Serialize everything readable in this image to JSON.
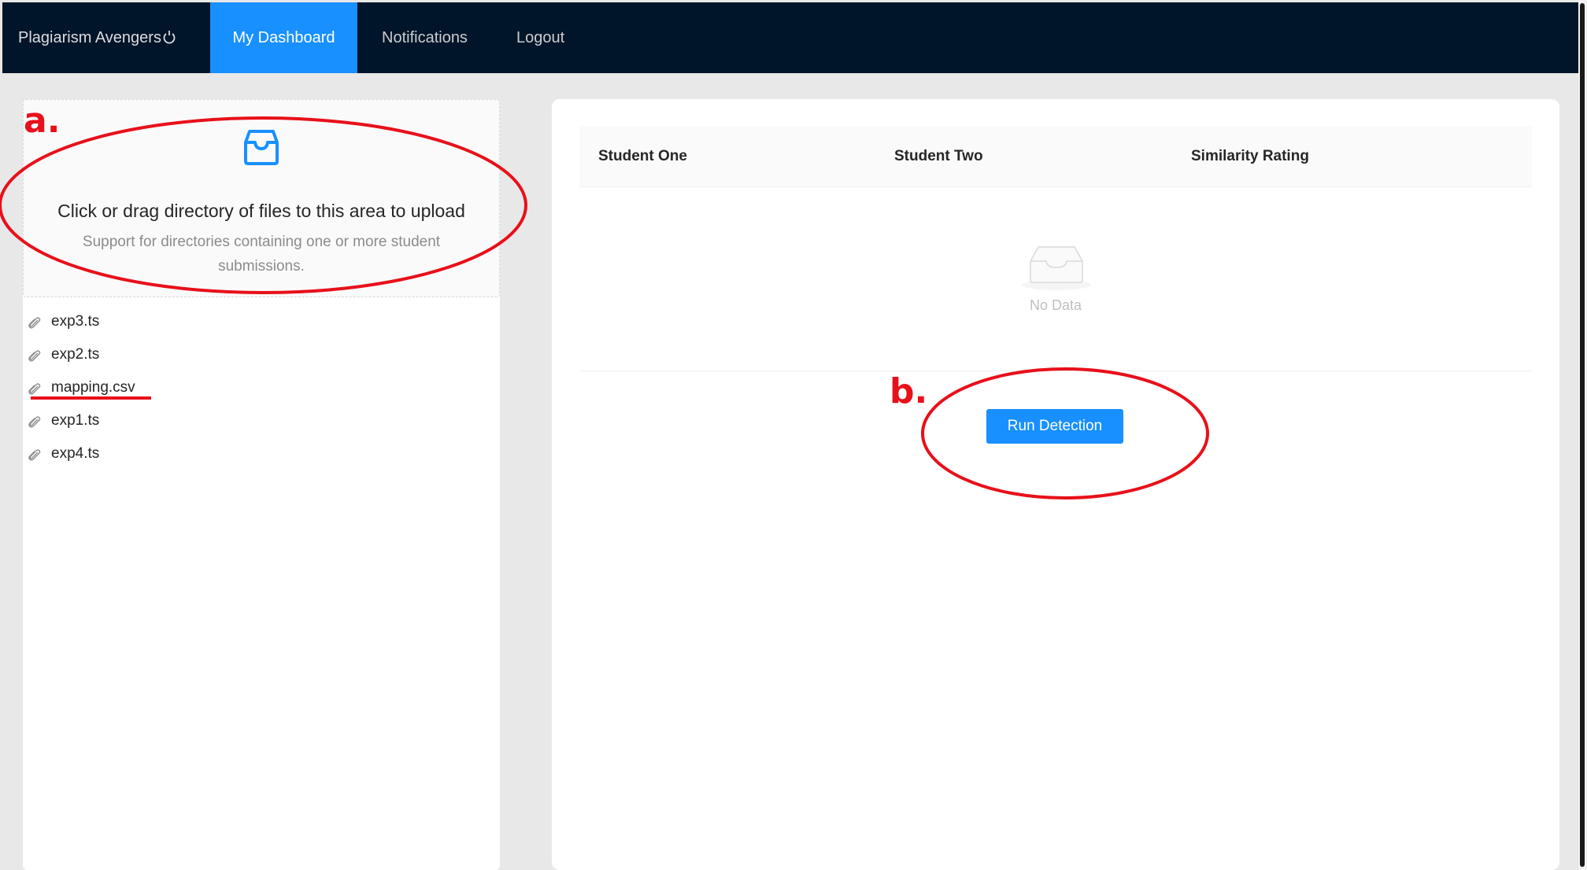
{
  "nav": {
    "brand": "Plagiarism Avengers",
    "tabs": [
      "My Dashboard",
      "Notifications",
      "Logout"
    ],
    "active_tab": "My Dashboard"
  },
  "upload": {
    "title": "Click or drag directory of files to this area to upload",
    "hint": "Support for directories containing one or more student submissions."
  },
  "files": [
    "exp3.ts",
    "exp2.ts",
    "mapping.csv",
    "exp1.ts",
    "exp4.ts"
  ],
  "table": {
    "columns": [
      "Student One",
      "Student Two",
      "Similarity Rating"
    ],
    "empty_text": "No Data"
  },
  "actions": {
    "run_label": "Run Detection"
  },
  "annotations": {
    "label_a": "a.",
    "label_b": "b."
  },
  "colors": {
    "nav_bg": "#001529",
    "accent": "#1890ff",
    "annotation": "#e8101a"
  }
}
